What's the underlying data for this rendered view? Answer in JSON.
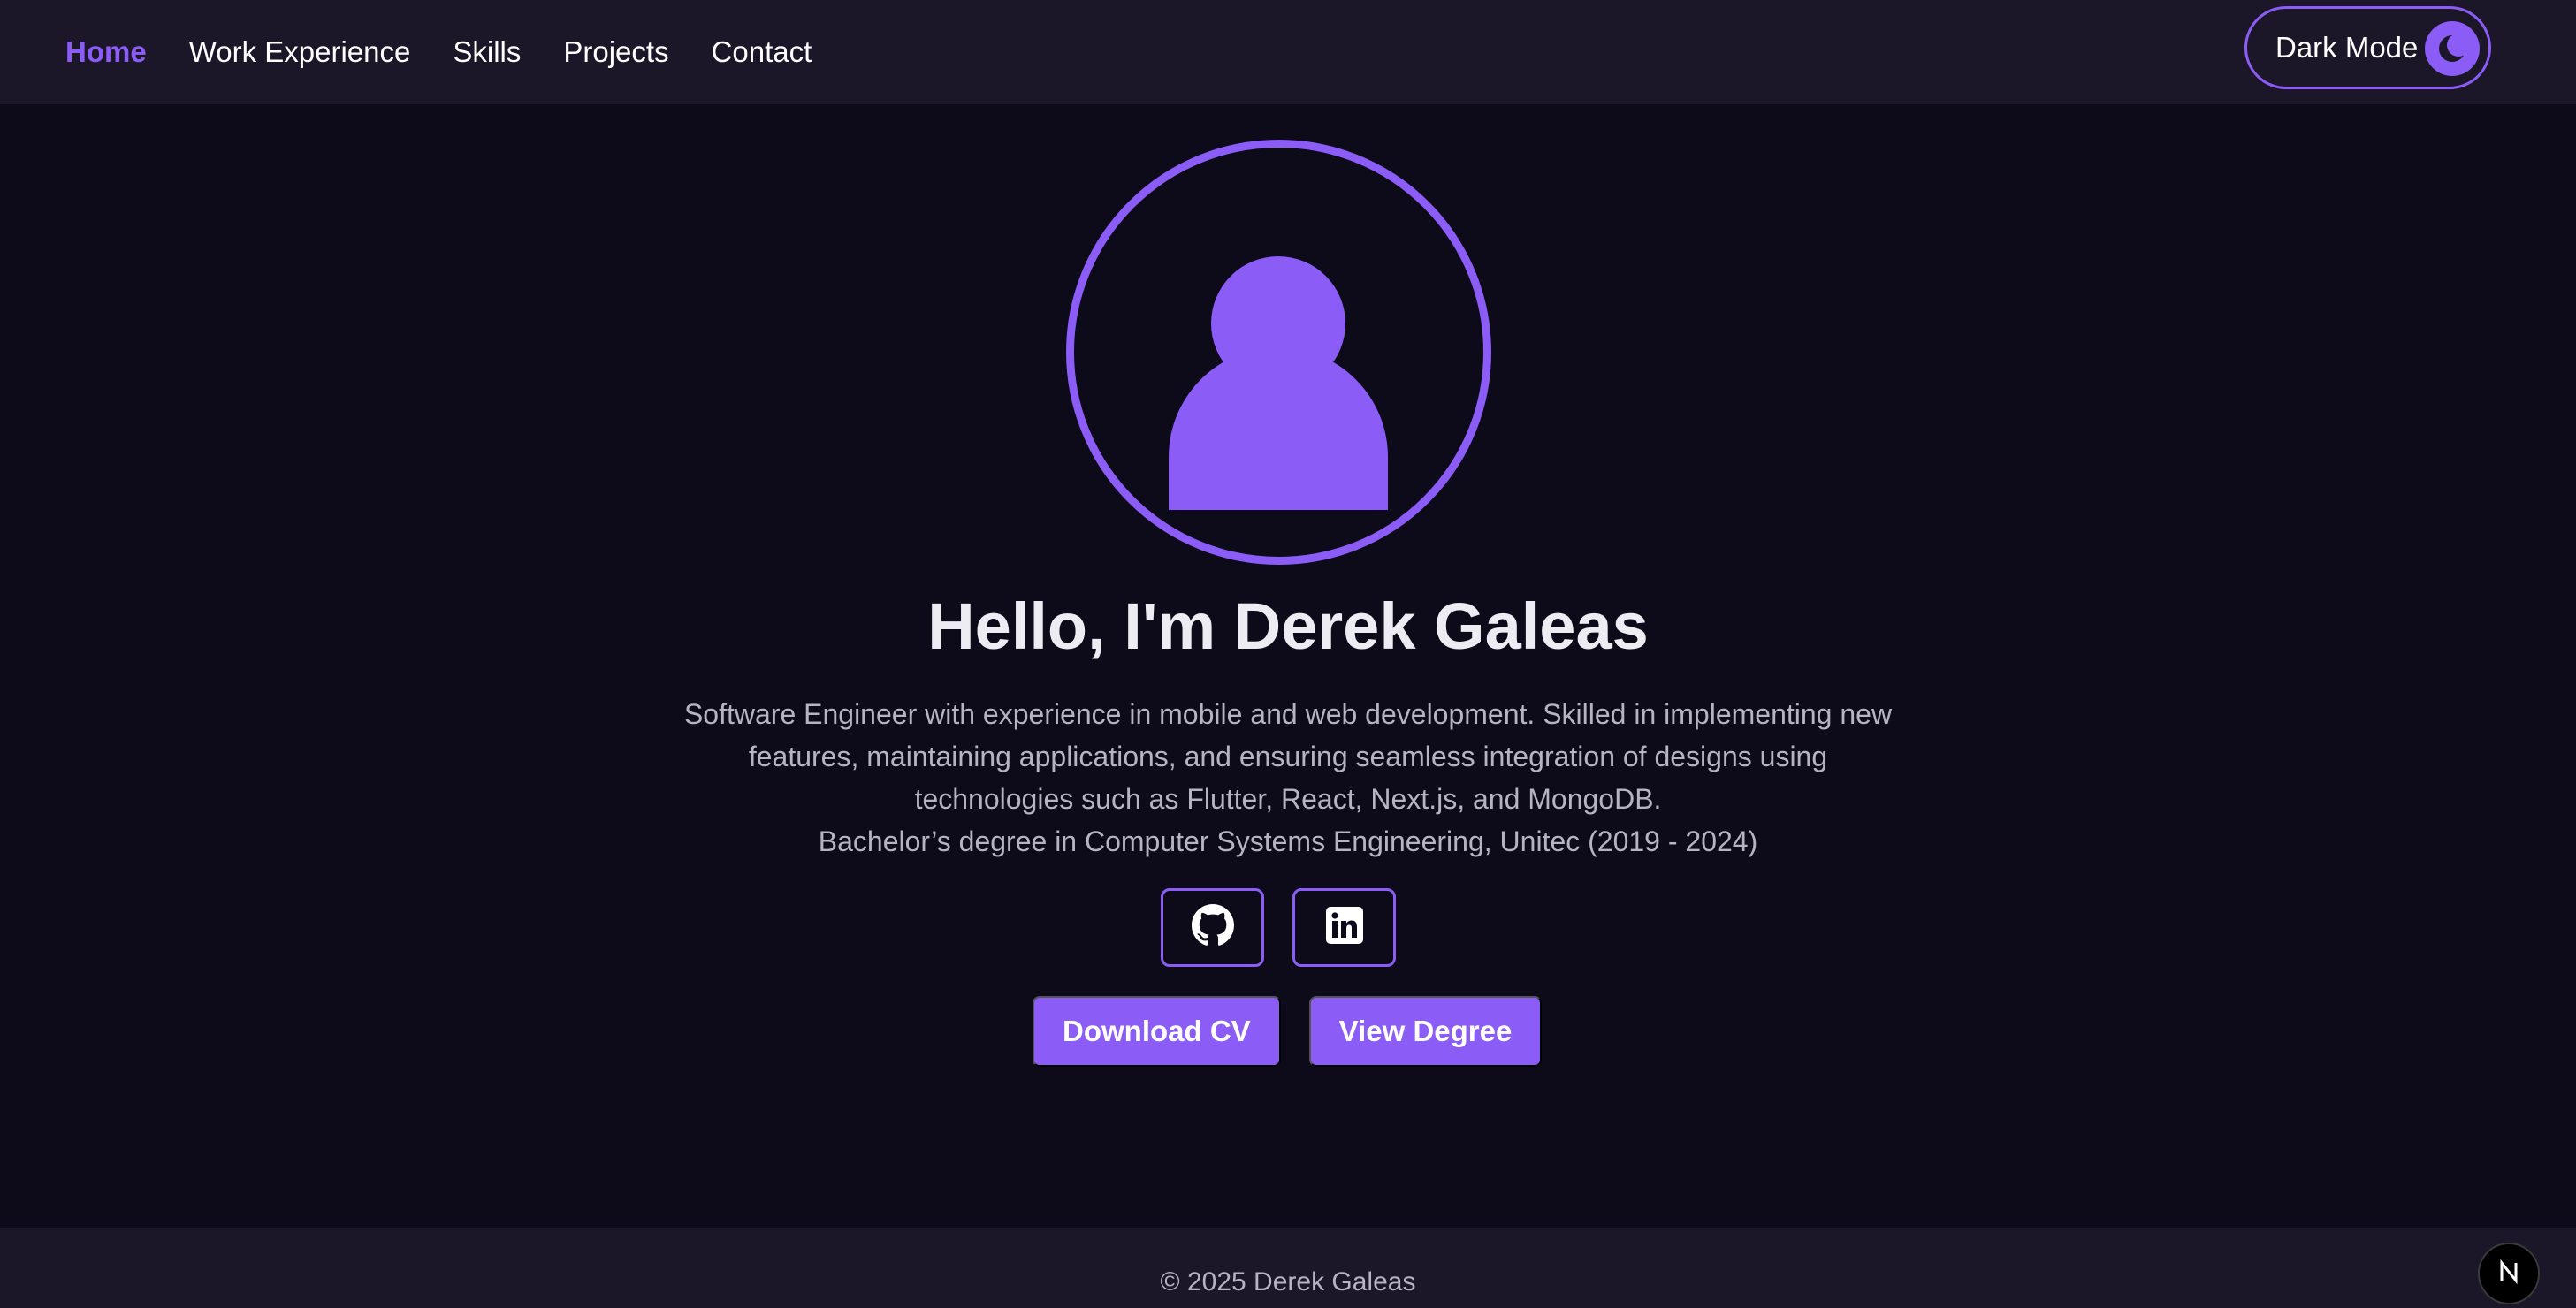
{
  "nav": {
    "items": [
      {
        "label": "Home",
        "active": true
      },
      {
        "label": "Work Experience",
        "active": false
      },
      {
        "label": "Skills",
        "active": false
      },
      {
        "label": "Projects",
        "active": false
      },
      {
        "label": "Contact",
        "active": false
      }
    ],
    "theme_toggle": {
      "label": "Dark Mode",
      "icon": "moon-icon"
    }
  },
  "hero": {
    "avatar_icon": "user-avatar-icon",
    "headline": "Hello, I'm Derek Galeas",
    "bio_lines": [
      "Software Engineer with experience in mobile and web development. Skilled in implementing new features, maintaining applications, and ensuring seamless integration of designs using technologies such as Flutter, React, Next.js, and MongoDB.",
      "Bachelor’s degree in Computer Systems Engineering, Unitec (2019 - 2024)"
    ],
    "social_links": [
      {
        "name": "github",
        "icon": "github-icon"
      },
      {
        "name": "linkedin",
        "icon": "linkedin-icon"
      }
    ],
    "buttons": {
      "download_cv": "Download CV",
      "view_degree": "View Degree"
    }
  },
  "footer": {
    "copyright": "© 2025 Derek Galeas"
  },
  "dev_badge": {
    "label": "N",
    "icon": "nextjs-icon"
  },
  "colors": {
    "accent": "#8b5cf6",
    "background": "#0d0b1a",
    "navbar": "#1b1729",
    "heading": "#ececf2",
    "body_text": "#b6b4c2"
  }
}
